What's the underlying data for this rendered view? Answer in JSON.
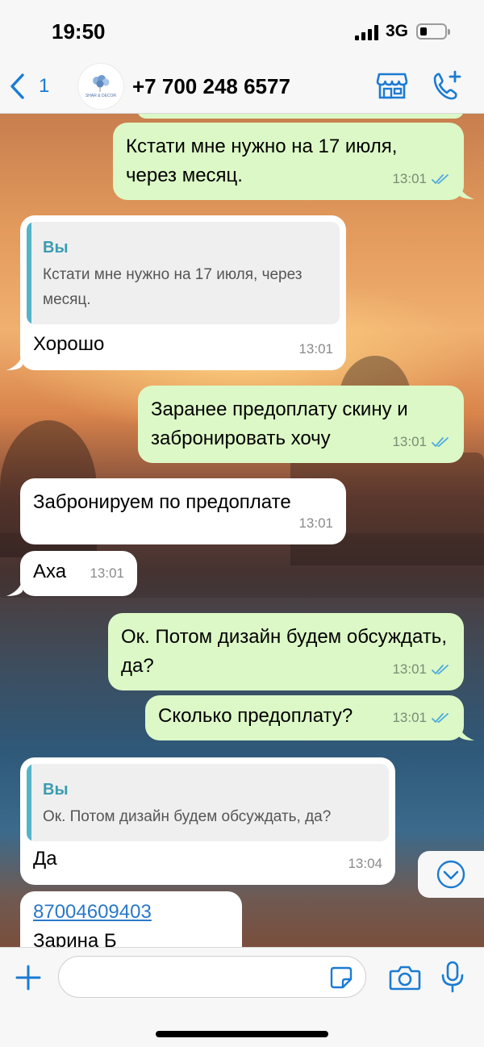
{
  "status_bar": {
    "time": "19:50",
    "network": "3G"
  },
  "header": {
    "back_count": "1",
    "contact_name": "+7 700 248 6577",
    "avatar_text": "SHAR & DECOR"
  },
  "messages": [
    {
      "text": "Кстати мне нужно на 17 июля, через месяц.",
      "time": "13:01"
    },
    {
      "quote_author": "Вы",
      "quote_text": "Кстати мне нужно на 17 июля, через месяц.",
      "text": "Хорошо",
      "time": "13:01"
    },
    {
      "text": "Заранее предоплату скину и забронировать хочу",
      "time": "13:01"
    },
    {
      "text": "Забронируем по предоплате",
      "time": "13:01"
    },
    {
      "text": "Аха",
      "time": "13:01"
    },
    {
      "text": "Ок. Потом дизайн будем обсуждать, да?",
      "time": "13:01"
    },
    {
      "text": "Сколько предоплату?",
      "time": "13:01"
    },
    {
      "quote_author": "Вы",
      "quote_text": "Ок. Потом дизайн будем обсуждать, да?",
      "text": "Да",
      "time": "13:04"
    },
    {
      "link": "87004609403",
      "text": "Зарина Б"
    }
  ],
  "composer": {
    "placeholder": "",
    "value": ""
  },
  "colors": {
    "outgoing_bubble": "#dcf8c6",
    "incoming_bubble": "#ffffff",
    "accent": "#1a7bd3",
    "read_ticks": "#4fa9e0",
    "quote_bar": "#53b4c8"
  },
  "icons": [
    "chevron-left-icon",
    "store-icon",
    "add-call-icon",
    "chevron-down-icon",
    "plus-icon",
    "sticker-icon",
    "camera-icon",
    "microphone-icon",
    "double-check-icon"
  ]
}
